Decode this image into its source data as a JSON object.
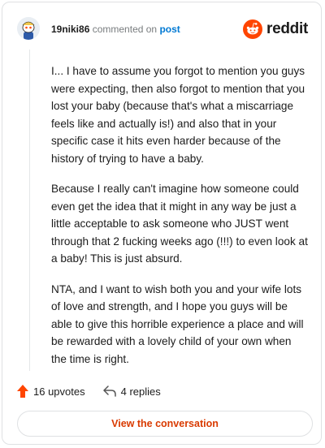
{
  "header": {
    "username": "19niki86",
    "action": "commented on",
    "post_link": "post",
    "brand": "reddit"
  },
  "comment": {
    "paragraphs": [
      "I... I have to assume you forgot to mention you guys were expecting, then also forgot to mention that you lost your baby (because that's what a miscarriage feels like and actually is!) and also that in your specific case it hits even harder because of the history of trying to have a baby.",
      "Because I really can't imagine how someone could even get the idea that it might in any way be just a little acceptable to ask someone who JUST went through that 2 fucking weeks ago (!!!) to even look at a baby! This is just absurd.",
      "NTA, and I want to wish both you and your wife lots of love and strength, and I hope you guys will be able to give this horrible experience a place and will be rewarded with a lovely child of your own when the time is right."
    ]
  },
  "footer": {
    "upvotes": "16 upvotes",
    "replies": "4 replies",
    "cta": "View the conversation"
  },
  "colors": {
    "brand_orange": "#ff4500",
    "link_blue": "#0079d3",
    "cta_text": "#d93a00"
  },
  "icons": {
    "avatar": "snoo-avatar",
    "brand_logo": "reddit-snoo-icon",
    "upvote": "upvote-arrow-icon",
    "reply": "reply-arrow-icon"
  }
}
